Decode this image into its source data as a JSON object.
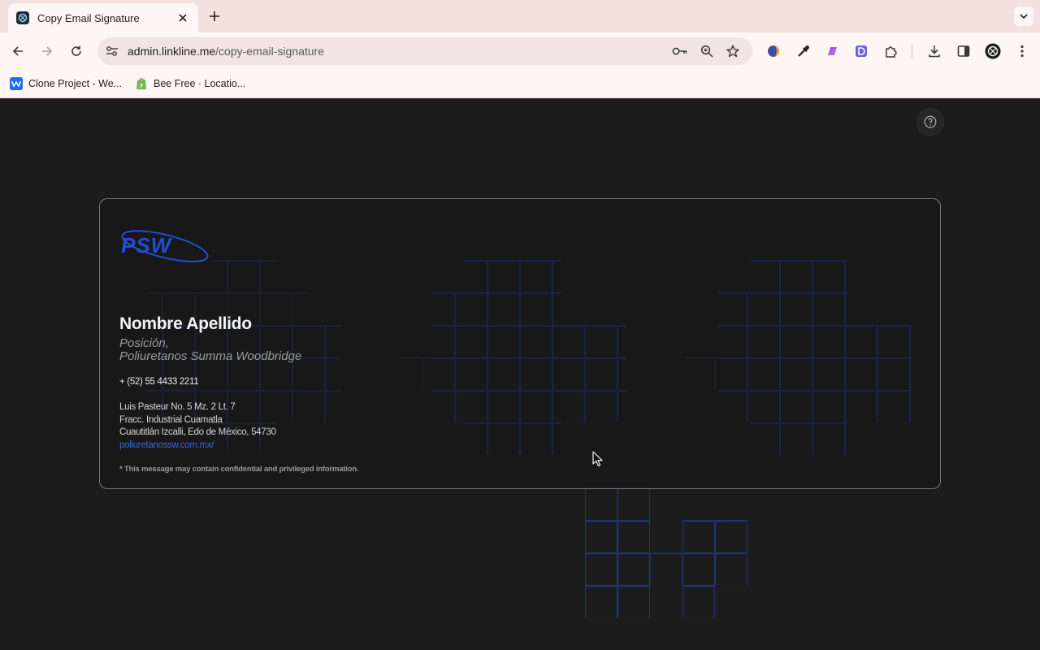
{
  "browser": {
    "tab_title": "Copy Email Signature",
    "url_domain": "admin.linkline.me",
    "url_path": "/copy-email-signature",
    "bookmarks": [
      {
        "label": "Clone Project - We..."
      },
      {
        "label": "Bee Free · Locatio..."
      }
    ]
  },
  "signature": {
    "logo_text": "PSW",
    "name": "Nombre Apellido",
    "position_line1": "Posición,",
    "position_line2": "Poliuretanos Summa Woodbridge",
    "phone": "+ (52) 55 4433 2211",
    "address_line1": "Luis Pasteur No. 5 Mz. 2 Lt. 7",
    "address_line2": "Fracc. Industrial Cuamatla",
    "address_line3": "Cuautitlán Izcalli, Edo de México, 54730",
    "website": "poliuretanossw.com.mx/",
    "disclaimer": "* This message may contain confidential and privileged information."
  },
  "colors": {
    "page_bg": "#1c1c1c",
    "brand_blue": "#1f4fd6",
    "link_blue": "#3b63e0",
    "card_border": "#7a7a7a"
  },
  "icons": {
    "help": "question-circle-icon"
  }
}
